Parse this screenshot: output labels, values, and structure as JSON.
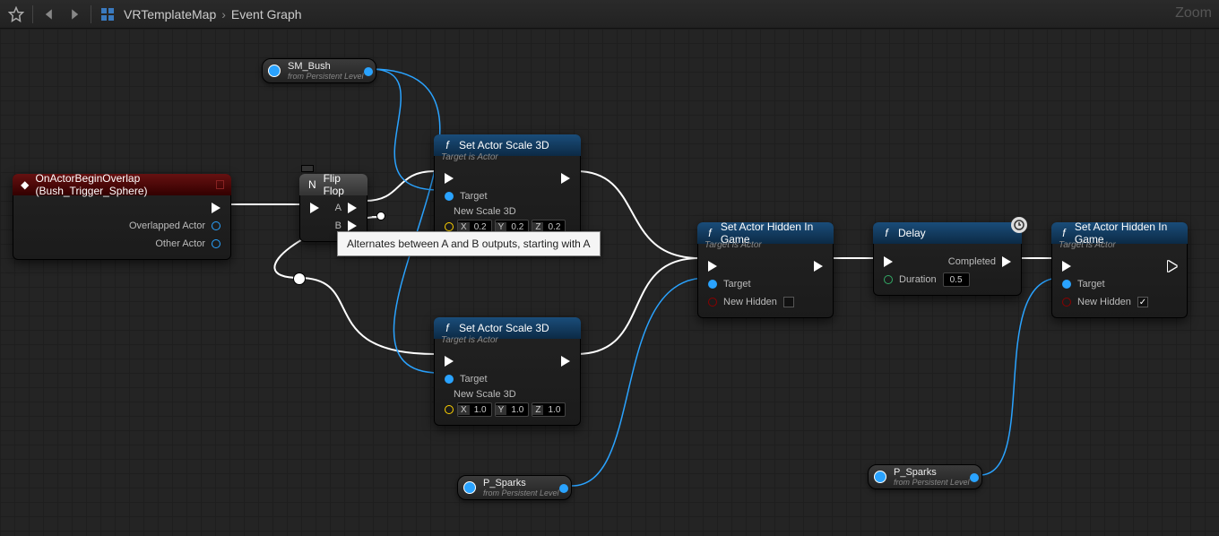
{
  "toolbar": {
    "zoom_label": "Zoom"
  },
  "breadcrumb": {
    "root": "VRTemplateMap",
    "leaf": "Event Graph"
  },
  "tooltip": {
    "text": "Alternates between A and B outputs, starting with A"
  },
  "vars": {
    "sm_bush": {
      "name": "SM_Bush",
      "sub": "from Persistent Level"
    },
    "p_sparks1": {
      "name": "P_Sparks",
      "sub": "from Persistent Level"
    },
    "p_sparks2": {
      "name": "P_Sparks",
      "sub": "from Persistent Level"
    }
  },
  "nodes": {
    "event": {
      "title": "OnActorBeginOverlap (Bush_Trigger_Sphere)",
      "overlapped": "Overlapped Actor",
      "other": "Other Actor"
    },
    "flipflop": {
      "title": "Flip Flop",
      "a": "A",
      "b": "B"
    },
    "scale1": {
      "title": "Set Actor Scale 3D",
      "sub": "Target is Actor",
      "target": "Target",
      "newscale": "New Scale 3D",
      "x": "0.2",
      "y": "0.2",
      "z": "0.2"
    },
    "scale2": {
      "title": "Set Actor Scale 3D",
      "sub": "Target is Actor",
      "target": "Target",
      "newscale": "New Scale 3D",
      "x": "1.0",
      "y": "1.0",
      "z": "1.0"
    },
    "hidden1": {
      "title": "Set Actor Hidden In Game",
      "sub": "Target is Actor",
      "target": "Target",
      "newhidden": "New Hidden",
      "checked": false
    },
    "hidden2": {
      "title": "Set Actor Hidden In Game",
      "sub": "Target is Actor",
      "target": "Target",
      "newhidden": "New Hidden",
      "checked": true
    },
    "delay": {
      "title": "Delay",
      "completed": "Completed",
      "duration": "Duration",
      "value": "0.5"
    }
  }
}
